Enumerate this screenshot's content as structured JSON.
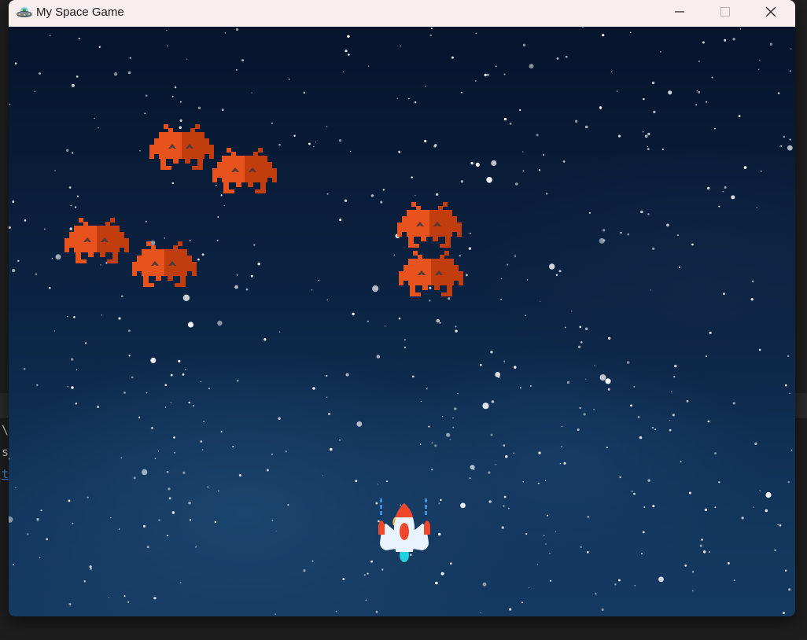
{
  "window": {
    "title": "My Space Game",
    "controls": [
      "minimize",
      "maximize",
      "close"
    ],
    "icons": {
      "app": "alien-ufo-icon",
      "minimize": "minimize-icon",
      "maximize": "maximize-icon",
      "close": "close-icon"
    }
  },
  "background_app": {
    "fragments": [
      "\\",
      "s.",
      "t"
    ]
  },
  "game": {
    "enemy_count": 6,
    "enemy_sprite": "pixel-invader-icon",
    "player_sprite": "rocket-ship-icon",
    "colors": {
      "enemy": "#e8521c",
      "enemy_shade": "#c23d0d",
      "ship_body": "#e9f3ff",
      "ship_accent": "#f0462a",
      "space": "#0b2342"
    }
  }
}
